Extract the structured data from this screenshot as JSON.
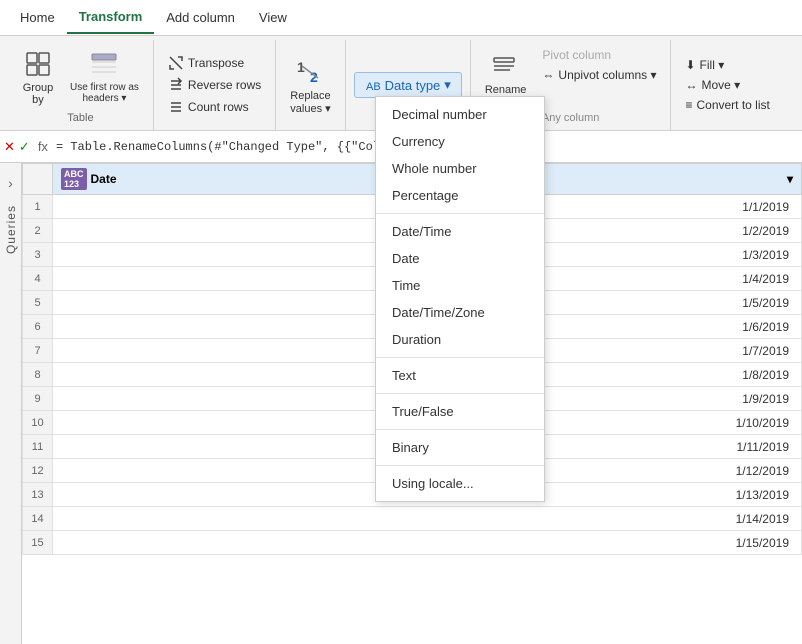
{
  "menubar": {
    "items": [
      "Home",
      "Transform",
      "Add column",
      "View"
    ],
    "active": "Transform"
  },
  "ribbon": {
    "groups": [
      {
        "label": "Table",
        "buttons": [
          {
            "id": "group-by",
            "icon": "⊞",
            "label": "Group\nby"
          },
          {
            "id": "use-first-row",
            "label": "Use first row as\nheaders"
          }
        ]
      },
      {
        "label": "",
        "small_buttons": [
          {
            "id": "transpose",
            "icon": "⇄",
            "label": "Transpose"
          },
          {
            "id": "reverse-rows",
            "icon": "↕",
            "label": "Reverse rows"
          },
          {
            "id": "count-rows",
            "icon": "≡",
            "label": "Count rows"
          }
        ]
      },
      {
        "label": "",
        "buttons": [
          {
            "id": "replace-values",
            "label": "Replace\nvalues"
          }
        ]
      },
      {
        "label": "",
        "buttons": [
          {
            "id": "data-type",
            "label": "Data type",
            "dropdown": true
          }
        ],
        "dropdown_items": [
          {
            "id": "decimal",
            "label": "Decimal number",
            "divider": false
          },
          {
            "id": "currency",
            "label": "Currency",
            "divider": false
          },
          {
            "id": "whole",
            "label": "Whole number",
            "divider": false
          },
          {
            "id": "percentage",
            "label": "Percentage",
            "divider": true
          },
          {
            "id": "datetime",
            "label": "Date/Time",
            "divider": false
          },
          {
            "id": "date",
            "label": "Date",
            "divider": false
          },
          {
            "id": "time",
            "label": "Time",
            "divider": false
          },
          {
            "id": "datetimezone",
            "label": "Date/Time/Zone",
            "divider": false
          },
          {
            "id": "duration",
            "label": "Duration",
            "divider": true
          },
          {
            "id": "text",
            "label": "Text",
            "divider": true
          },
          {
            "id": "truefalse",
            "label": "True/False",
            "divider": true
          },
          {
            "id": "binary",
            "label": "Binary",
            "divider": true
          },
          {
            "id": "locale",
            "label": "Using locale...",
            "divider": false
          }
        ]
      },
      {
        "label": "Any column",
        "buttons": [
          {
            "id": "rename",
            "label": "Rename"
          },
          {
            "id": "pivot-col",
            "label": "Pivot column"
          },
          {
            "id": "unpivot-cols",
            "label": "Unpivot columns"
          }
        ]
      },
      {
        "label": "",
        "buttons": [
          {
            "id": "fill",
            "label": "Fill"
          },
          {
            "id": "move",
            "label": "Move"
          },
          {
            "id": "convert-to-list",
            "label": "Convert to list"
          }
        ]
      }
    ]
  },
  "formula_bar": {
    "formula": "= Table.RenameColumns(#\"Changed Type\", {{\"Column1\", \"Date\"}})"
  },
  "sidebar": {
    "label": "Queries",
    "arrow": "›"
  },
  "table": {
    "columns": [
      {
        "type": "ABC\n123",
        "name": "Date"
      }
    ],
    "rows": [
      {
        "num": 1,
        "date": "1/1/2019"
      },
      {
        "num": 2,
        "date": "1/2/2019"
      },
      {
        "num": 3,
        "date": "1/3/2019"
      },
      {
        "num": 4,
        "date": "1/4/2019"
      },
      {
        "num": 5,
        "date": "1/5/2019"
      },
      {
        "num": 6,
        "date": "1/6/2019"
      },
      {
        "num": 7,
        "date": "1/7/2019"
      },
      {
        "num": 8,
        "date": "1/8/2019"
      },
      {
        "num": 9,
        "date": "1/9/2019"
      },
      {
        "num": 10,
        "date": "1/10/2019"
      },
      {
        "num": 11,
        "date": "1/11/2019"
      },
      {
        "num": 12,
        "date": "1/12/2019"
      },
      {
        "num": 13,
        "date": "1/13/2019"
      },
      {
        "num": 14,
        "date": "1/14/2019"
      },
      {
        "num": 15,
        "date": "1/15/2019"
      }
    ]
  }
}
